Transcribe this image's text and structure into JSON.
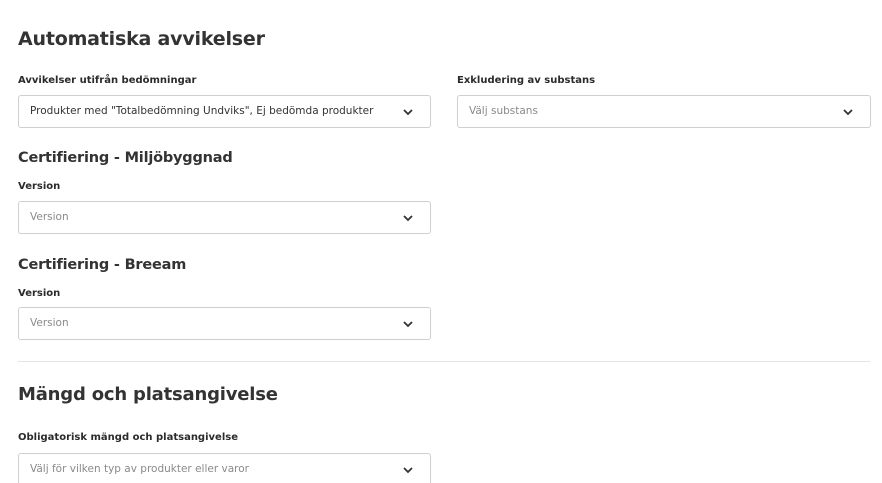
{
  "sections": {
    "automatic": {
      "title": "Automatiska avvikelser",
      "assessment": {
        "label": "Avvikelser utifrån bedömningar",
        "value": "Produkter med \"Totalbedömning Undviks\", Ej bedömda produkter"
      },
      "substance": {
        "label": "Exkludering av substans",
        "placeholder": "Välj substans"
      }
    },
    "miljobyggnad": {
      "title": "Certifiering - Miljöbyggnad",
      "version_label": "Version",
      "version_placeholder": "Version"
    },
    "breeam": {
      "title": "Certifiering - Breeam",
      "version_label": "Version",
      "version_placeholder": "Version"
    },
    "quantity": {
      "title": "Mängd och platsangivelse",
      "label": "Obligatorisk mängd och platsangivelse",
      "placeholder": "Välj för vilken typ av produkter eller varor"
    }
  },
  "icons": {
    "dropdown": "chevron-down-icon"
  },
  "colors": {
    "border": "#cfcfcf",
    "placeholder": "#8a8a8a",
    "divider": "#e4e4e4"
  }
}
